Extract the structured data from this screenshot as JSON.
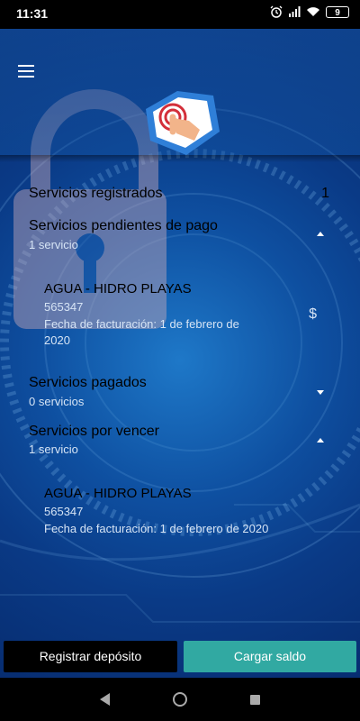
{
  "status_bar": {
    "time": "11:31",
    "battery": "9"
  },
  "summary": [
    {
      "title": "Servicios registrados",
      "count": "1"
    },
    {
      "title": "Servicios pendientes de pago",
      "subtitle": "1 servicio"
    },
    {
      "title": "Servicios pagados",
      "subtitle": "0 servicios"
    },
    {
      "title": "Servicios por vencer",
      "subtitle": "1 servicio"
    }
  ],
  "pending_items": [
    {
      "name": "AGUA - HIDRO PLAYAS",
      "code": "565347",
      "date_line1": "Fecha de facturación: 1 de febrero de",
      "date_line2": "2020",
      "currency_icon": "$"
    }
  ],
  "due_items": [
    {
      "name": "AGUA - HIDRO PLAYAS",
      "code": "565347",
      "date": "Fecha de facturación: 1 de febrero de 2020"
    }
  ],
  "buttons": {
    "register_deposit": "Registrar depósito",
    "load_balance": "Cargar saldo"
  },
  "colors": {
    "accent": "#31a9a2",
    "background": "#0e4fa0",
    "logo_red": "#d32f3a"
  }
}
